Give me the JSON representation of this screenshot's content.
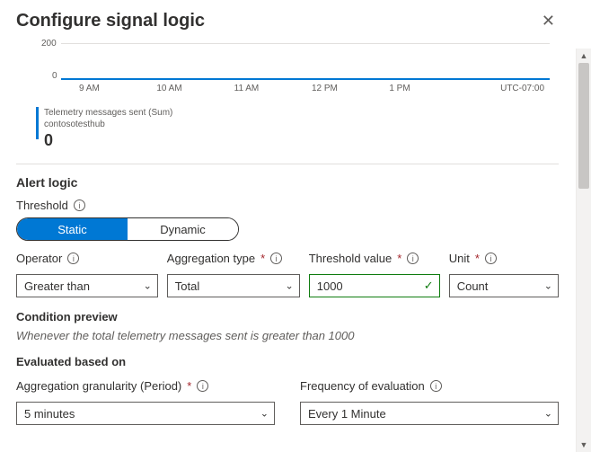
{
  "header": {
    "title": "Configure signal logic"
  },
  "chart_data": {
    "type": "line",
    "x_ticks": [
      "9 AM",
      "10 AM",
      "11 AM",
      "12 PM",
      "1 PM"
    ],
    "y_ticks": [
      0,
      200
    ],
    "timezone": "UTC-07:00",
    "series": [
      {
        "name": "Telemetry messages sent (Sum)",
        "source": "contosotesthub",
        "values": [
          0,
          0,
          0,
          0,
          0
        ],
        "current": "0"
      }
    ],
    "ylim": [
      0,
      200
    ]
  },
  "alert_logic": {
    "section_title": "Alert logic",
    "threshold_label": "Threshold",
    "tabs": {
      "static": "Static",
      "dynamic": "Dynamic",
      "active": "static"
    },
    "operator": {
      "label": "Operator",
      "value": "Greater than"
    },
    "aggregation": {
      "label": "Aggregation type",
      "value": "Total"
    },
    "threshold_value": {
      "label": "Threshold value",
      "value": "1000"
    },
    "unit": {
      "label": "Unit",
      "value": "Count"
    },
    "condition_preview_label": "Condition preview",
    "condition_preview": "Whenever the total telemetry messages sent is greater than 1000"
  },
  "evaluation": {
    "section_title": "Evaluated based on",
    "granularity": {
      "label": "Aggregation granularity (Period)",
      "value": "5 minutes"
    },
    "frequency": {
      "label": "Frequency of evaluation",
      "value": "Every 1 Minute"
    }
  }
}
